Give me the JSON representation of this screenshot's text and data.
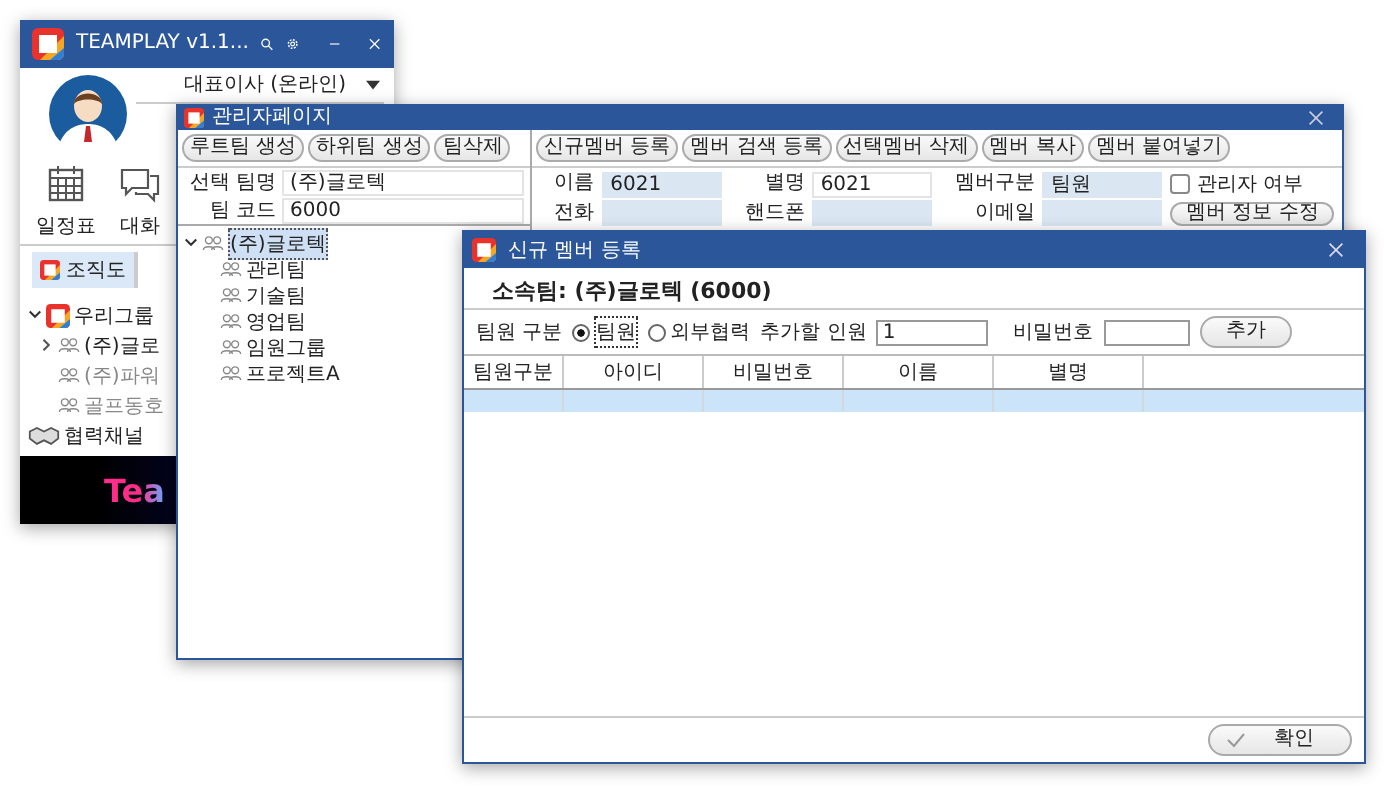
{
  "main_window": {
    "title": "TEAMPLAY v1.1...",
    "user_status": "대표이사 (온라인)",
    "nav": [
      {
        "label": "일정표",
        "kind": "calendar"
      },
      {
        "label": "대화",
        "kind": "chat"
      }
    ],
    "tabs": [
      {
        "label": "조직도",
        "selected": true
      }
    ],
    "tree": [
      {
        "label": "우리그룹",
        "kind": "group",
        "expanded": true,
        "children": [
          {
            "label": "(주)글로",
            "has_children": true,
            "dimmed": false
          },
          {
            "label": "(주)파워",
            "has_children": false,
            "dimmed": true
          },
          {
            "label": "골프동호",
            "has_children": false,
            "dimmed": true
          }
        ]
      },
      {
        "label": "협력채널",
        "kind": "partner"
      }
    ],
    "banner_text": "Tea"
  },
  "admin_window": {
    "title": "관리자페이지",
    "left_buttons": [
      "루트팀 생성",
      "하위팀 생성",
      "팀삭제"
    ],
    "right_buttons": [
      "신규멤버 등록",
      "멤버 검색 등록",
      "선택멤버 삭제",
      "멤버 복사",
      "멤버 붙여넣기"
    ],
    "team_fields": [
      {
        "label": "선택 팀명",
        "value": "(주)글로텍"
      },
      {
        "label": "팀 코드",
        "value": "6000"
      }
    ],
    "member_fields": [
      {
        "label": "이름",
        "value": "6021",
        "highlighted": true
      },
      {
        "label": "별명",
        "value": "6021",
        "highlighted": false
      },
      {
        "label": "멤버구분",
        "value": "팀원",
        "highlighted": true
      },
      {
        "label": "전화",
        "highlighted": true
      },
      {
        "label": "핸드폰",
        "highlighted": true
      },
      {
        "label": "이메일",
        "highlighted": true
      }
    ],
    "admin_checkbox": {
      "label": "관리자 여부",
      "checked": false
    },
    "edit_button": "멤버 정보 수정",
    "tree": [
      {
        "label": "(주)글로텍",
        "selected": true,
        "expanded": true,
        "children": [
          {
            "label": "관리팀",
            "selected": false
          },
          {
            "label": "기술팀",
            "selected": false
          },
          {
            "label": "영업팀",
            "selected": false
          },
          {
            "label": "임원그룹",
            "selected": false
          },
          {
            "label": "프로젝트A",
            "selected": false
          }
        ]
      }
    ]
  },
  "dialog": {
    "title": "신규 멤버 등록",
    "team_line": "소속팀: (주)글로텍 (6000)",
    "type_label": "팀원 구분",
    "radios": [
      {
        "label": "팀원",
        "selected": true
      },
      {
        "label": "외부협력",
        "selected": false
      }
    ],
    "count_field": {
      "label": "추가할 인원",
      "value": "1"
    },
    "password_field": {
      "label": "비밀번호"
    },
    "add_button": "추가",
    "table": {
      "columns": [
        "팀원구분",
        "아이디",
        "비밀번호",
        "이름",
        "별명"
      ],
      "rows": [
        {
          "selected": true
        }
      ]
    },
    "confirm_button": "확인"
  }
}
